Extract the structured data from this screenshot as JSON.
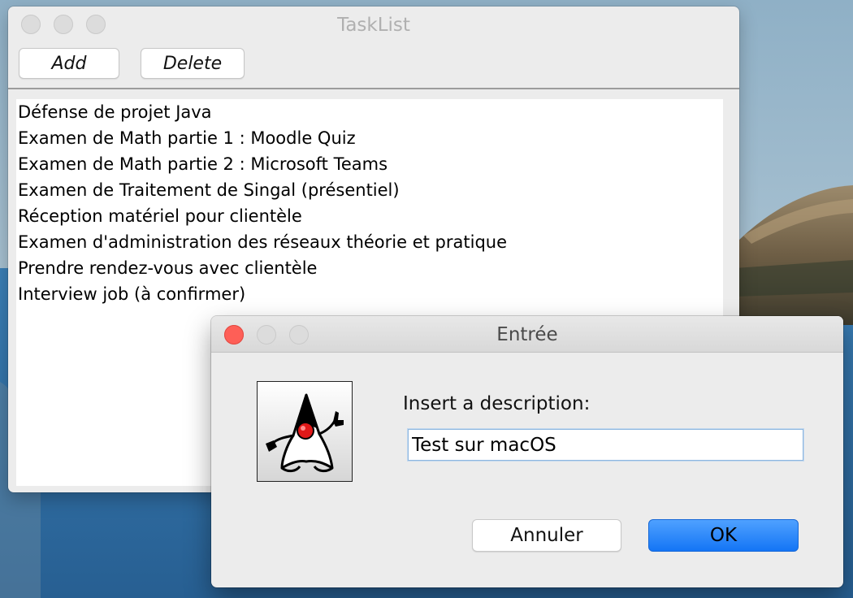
{
  "main_window": {
    "title": "TaskList",
    "toolbar": {
      "add_label": "Add",
      "delete_label": "Delete"
    },
    "tasks": [
      "Défense de projet Java",
      "Examen de Math partie 1 : Moodle Quiz",
      "Examen de Math partie 2 : Microsoft Teams",
      "Examen de Traitement de Singal (présentiel)",
      "Réception matériel pour clientèle",
      "Examen d'administration des réseaux théorie et pratique",
      "Prendre rendez-vous avec clientèle",
      "Interview job (à confirmer)"
    ]
  },
  "dialog": {
    "title": "Entrée",
    "prompt": "Insert a description:",
    "input_value": "Test sur macOS",
    "cancel_label": "Annuler",
    "ok_label": "OK",
    "icon": "java-duke-icon"
  },
  "colors": {
    "ok_button": "#1475f5",
    "close_button_active": "#fe5f57",
    "window_bg": "#ececec"
  }
}
